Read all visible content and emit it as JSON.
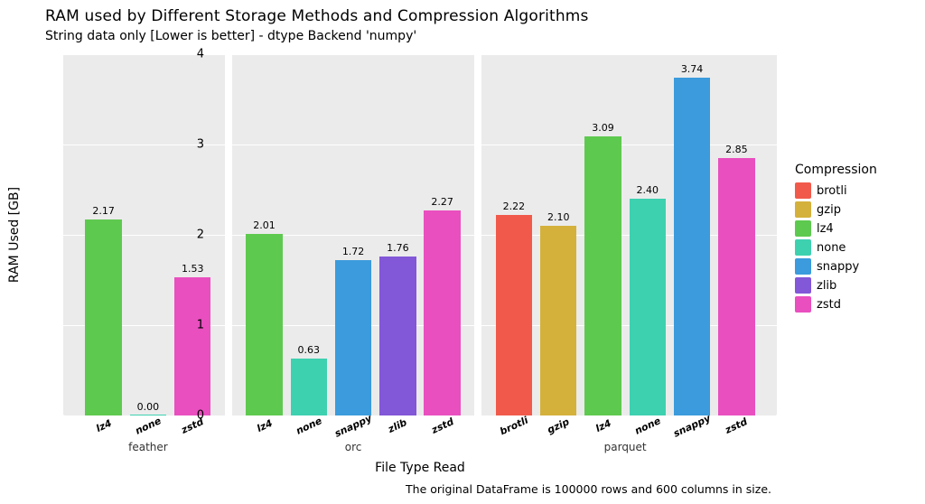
{
  "chart_data": {
    "type": "bar",
    "title": "RAM used by Different Storage Methods and Compression Algorithms",
    "subtitle": "String data only [Lower is better] - dtype Backend 'numpy'",
    "ylabel": "RAM Used [GB]",
    "xlabel": "File Type Read",
    "caption": "The original DataFrame is 100000 rows and 600 columns in size.",
    "ylim": [
      0,
      4
    ],
    "yticks": [
      0,
      1,
      2,
      3,
      4
    ],
    "legend_title": "Compression",
    "colors": {
      "brotli": "#f15a4a",
      "gzip": "#d4b13b",
      "lz4": "#5ec94f",
      "none": "#3ed1b0",
      "snappy": "#3b9bdc",
      "zlib": "#8257d8",
      "zstd": "#e94fbf"
    },
    "groups": [
      {
        "name": "feather",
        "bars": [
          {
            "compression": "lz4",
            "value": 2.17
          },
          {
            "compression": "none",
            "value": 0.0
          },
          {
            "compression": "zstd",
            "value": 1.53
          }
        ]
      },
      {
        "name": "orc",
        "bars": [
          {
            "compression": "lz4",
            "value": 2.01
          },
          {
            "compression": "none",
            "value": 0.63
          },
          {
            "compression": "snappy",
            "value": 1.72
          },
          {
            "compression": "zlib",
            "value": 1.76
          },
          {
            "compression": "zstd",
            "value": 2.27
          }
        ]
      },
      {
        "name": "parquet",
        "bars": [
          {
            "compression": "brotli",
            "value": 2.22
          },
          {
            "compression": "gzip",
            "value": 2.1
          },
          {
            "compression": "lz4",
            "value": 3.09
          },
          {
            "compression": "none",
            "value": 2.4
          },
          {
            "compression": "snappy",
            "value": 3.74
          },
          {
            "compression": "zstd",
            "value": 2.85
          }
        ]
      }
    ],
    "legend_order": [
      "brotli",
      "gzip",
      "lz4",
      "none",
      "snappy",
      "zlib",
      "zstd"
    ]
  }
}
